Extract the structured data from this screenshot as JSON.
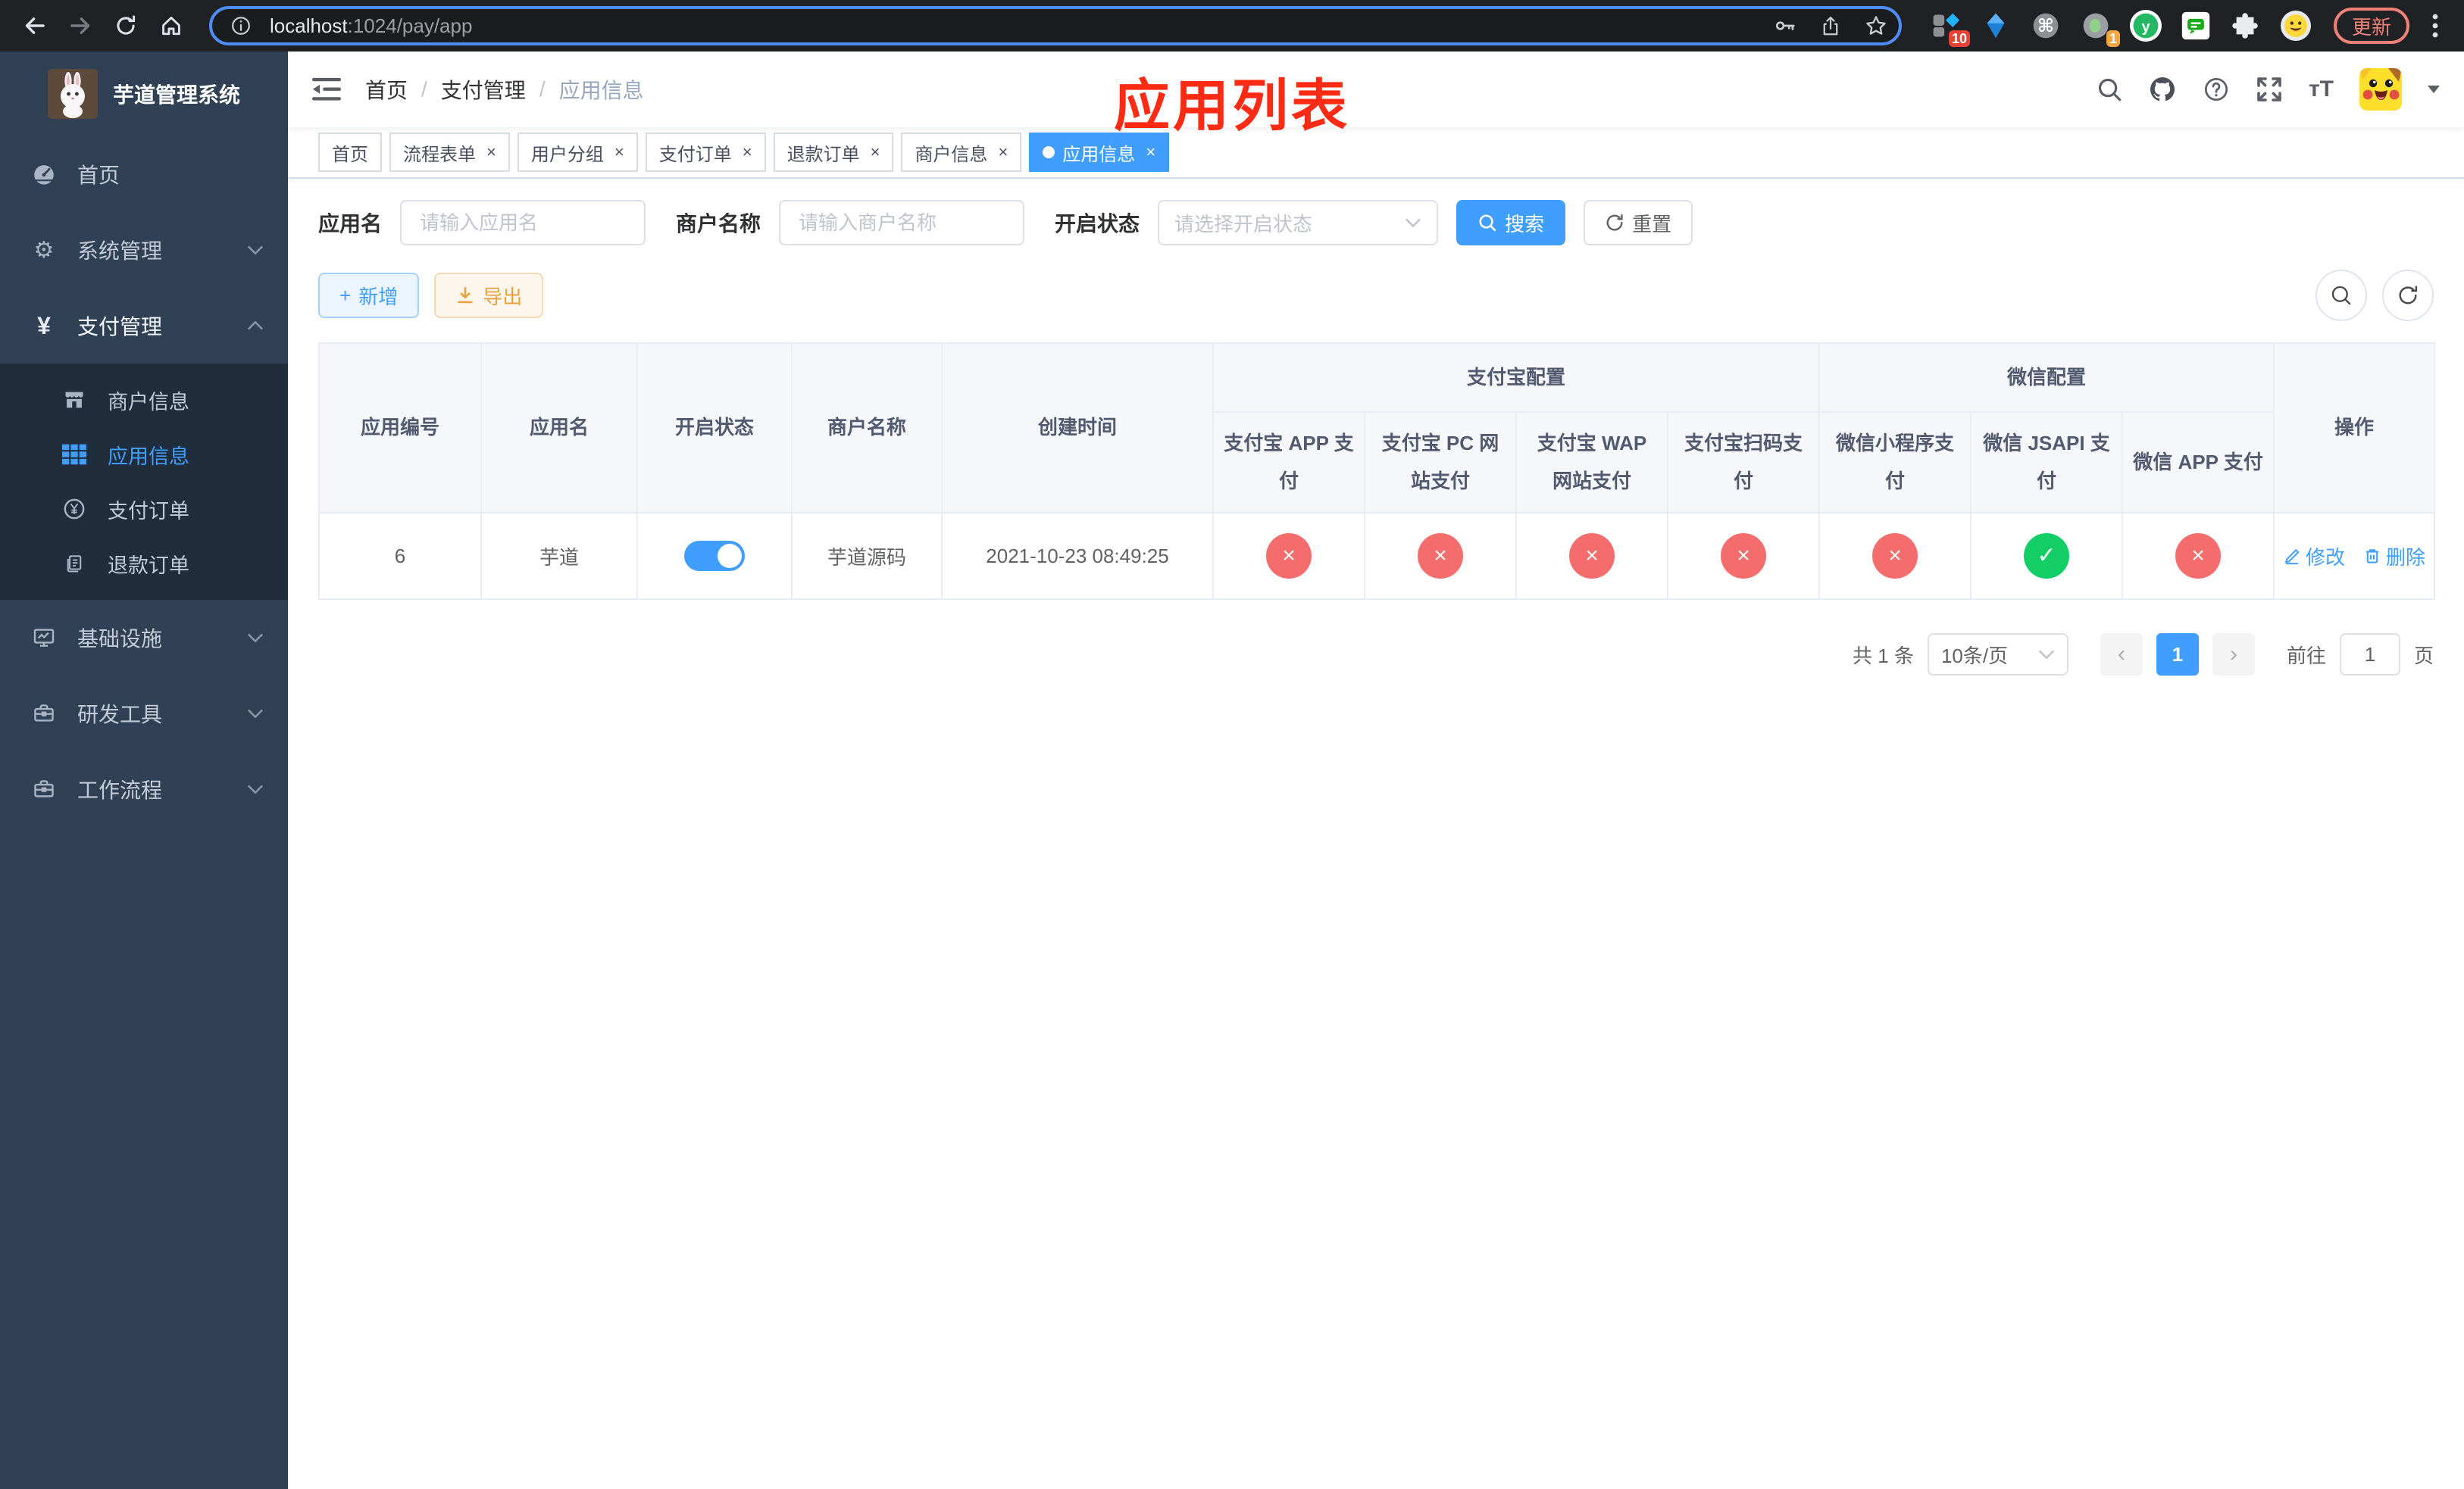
{
  "browser": {
    "url": {
      "host": "localhost",
      "rest": ":1024/pay/app"
    },
    "update_label": "更新",
    "ext_badges": {
      "grid": "10",
      "tree": "1"
    }
  },
  "sidebar": {
    "title": "芋道管理系统",
    "items": [
      {
        "label": "首页"
      },
      {
        "label": "系统管理"
      },
      {
        "label": "支付管理"
      },
      {
        "label": "基础设施"
      },
      {
        "label": "研发工具"
      },
      {
        "label": "工作流程"
      }
    ],
    "sub_items": [
      {
        "label": "商户信息"
      },
      {
        "label": "应用信息"
      },
      {
        "label": "支付订单"
      },
      {
        "label": "退款订单"
      }
    ]
  },
  "navbar": {
    "breadcrumb": [
      "首页",
      "支付管理",
      "应用信息"
    ],
    "separator": "/",
    "annotation": "应用列表"
  },
  "tags": [
    {
      "label": "首页"
    },
    {
      "label": "流程表单"
    },
    {
      "label": "用户分组"
    },
    {
      "label": "支付订单"
    },
    {
      "label": "退款订单"
    },
    {
      "label": "商户信息"
    },
    {
      "label": "应用信息"
    }
  ],
  "search": {
    "app_name_label": "应用名",
    "app_name_placeholder": "请输入应用名",
    "merchant_label": "商户名称",
    "merchant_placeholder": "请输入商户名称",
    "status_label": "开启状态",
    "status_placeholder": "请选择开启状态",
    "search_label": "搜索",
    "reset_label": "重置"
  },
  "toolbar": {
    "add_label": "新增",
    "export_label": "导出"
  },
  "table": {
    "columns": {
      "app_id": "应用编号",
      "app_name": "应用名",
      "status": "开启状态",
      "merchant": "商户名称",
      "created": "创建时间",
      "alipay_group": "支付宝配置",
      "wechat_group": "微信配置",
      "actions": "操作",
      "pay": [
        "支付宝 APP 支付",
        "支付宝 PC 网站支付",
        "支付宝 WAP 网站支付",
        "支付宝扫码支付",
        "微信小程序支付",
        "微信 JSAPI 支付",
        "微信 APP 支付"
      ]
    },
    "row": {
      "id": "6",
      "name": "芋道",
      "enabled": true,
      "merchant": "芋道源码",
      "created": "2021-10-23 08:49:25",
      "pay_status": [
        false,
        false,
        false,
        false,
        false,
        true,
        false
      ]
    },
    "actions": {
      "edit": "修改",
      "delete": "删除"
    }
  },
  "pagination": {
    "total": "共 1 条",
    "page_size": "10条/页",
    "page": "1",
    "goto_label": "前往",
    "goto_value": "1",
    "page_unit": "页"
  },
  "icons": {
    "check": "✓",
    "cross": "×",
    "close": "×",
    "plus": "+",
    "prev": "‹",
    "next": "›",
    "cmd": "⌘",
    "gear": "⚙",
    "yen": "¥",
    "text_size": "тT"
  },
  "colors": {
    "accent": "#409eff",
    "danger": "#f56c6c",
    "success": "#13ce66",
    "warning": "#e6a23c",
    "annotation_red": "#fe2b14",
    "sidebar_bg": "#304156",
    "submenu_bg": "#1f2d3d"
  }
}
